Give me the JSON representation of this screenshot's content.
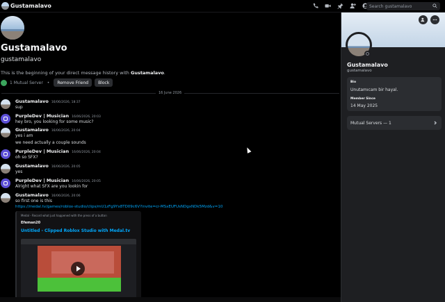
{
  "header": {
    "title": "Gustamalavo",
    "search_placeholder": "Search gustamalavo",
    "icons": [
      "phone-icon",
      "video-icon",
      "pin-icon",
      "add-member-icon",
      "profile-icon"
    ]
  },
  "intro": {
    "display_name": "Gustamalavo",
    "username": "gustamalavo",
    "text_prefix": "This is the beginning of your direct message history with ",
    "text_name": "Gustamalavo",
    "text_suffix": ".",
    "mutual_servers": "1 Mutual Server",
    "separator": "•",
    "remove_friend": "Remove Friend",
    "block": "Block"
  },
  "date_divider": "16 June 2026",
  "messages": [
    {
      "author": "Gustamalavo",
      "time": "16/06/2026, 18:37",
      "body": "sup"
    },
    {
      "author": "PurpleDev | Musician",
      "time": "16/06/2026, 20:03",
      "body": "hey bro, you looking for some music?"
    },
    {
      "author": "Gustamalavo",
      "time": "16/06/2026, 20:04",
      "body": "yes i am",
      "body2": "we need actually a couple sounds"
    },
    {
      "author": "PurpleDev | Musician",
      "time": "16/06/2026, 20:04",
      "body": "oh so SFX?"
    },
    {
      "author": "Gustamalavo",
      "time": "16/06/2026, 20:05",
      "body": "yes"
    },
    {
      "author": "PurpleDev | Musician",
      "time": "16/06/2026, 20:05",
      "body": "Alright what SFX are you lookin for"
    },
    {
      "author": "Gustamalavo",
      "time": "16/06/2026, 20:06",
      "body": "so first one is this",
      "link": "https://medal.tv/games/roblox-studio/clips/mU1zFg9Yx8TD09c6V?invite=cr-MSxEUFUsNDgxNDk5Mzd&v=10"
    }
  ],
  "embed": {
    "provider": "Medal - Record what just happened with the press of a button",
    "author": "Efeman20",
    "title": "Untitled - Clipped Roblox Studio with Medal.tv"
  },
  "profile": {
    "display_name": "Gustamalavo",
    "username": "gustamalavo",
    "bio_label": "Bio",
    "bio": "Unutamıcam bir hayal.",
    "member_since_label": "Member Since",
    "member_since": "14 May 2025",
    "mutual_servers": "Mutual Servers — 1"
  }
}
